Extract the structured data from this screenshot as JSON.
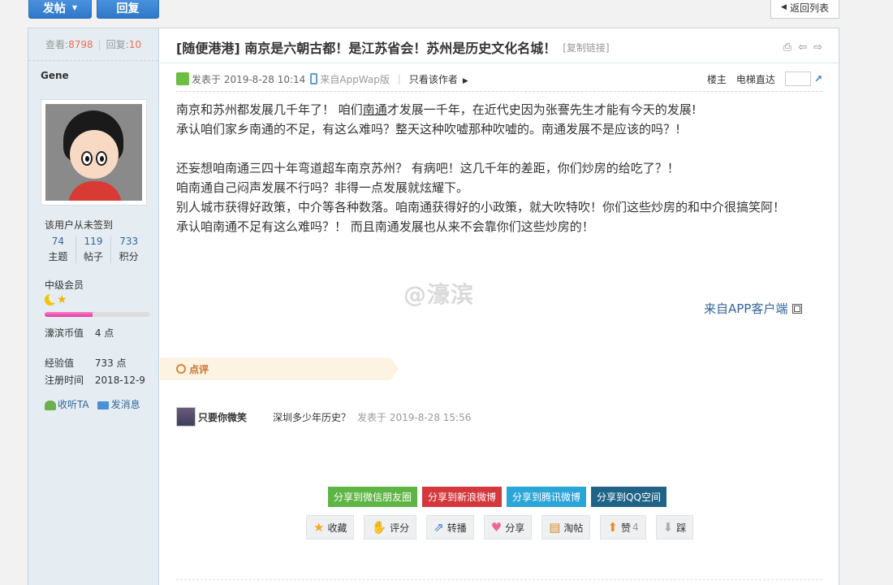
{
  "toolbar": {
    "post_label": "发帖",
    "reply_label": "回复",
    "back_label": "返回列表"
  },
  "sidebar": {
    "views_label": "查看:",
    "views": "8798",
    "replies_label": "回复:",
    "replies": "10",
    "username": "Gene",
    "signin_text": "该用户从未签到",
    "stats": [
      {
        "value": "74",
        "label": "主题"
      },
      {
        "value": "119",
        "label": "帖子"
      },
      {
        "value": "733",
        "label": "积分"
      }
    ],
    "level": "中级会员",
    "level_progress": 0.45,
    "coins_label": "濠滨币值",
    "coins": "4 点",
    "exp_label": "经验值",
    "exp": "733 点",
    "reg_label": "注册时间",
    "reg": "2018-12-9",
    "follow_label": "收听TA",
    "message_label": "发消息"
  },
  "post": {
    "title": "[随便港港] 南京是六朝古都！是江苏省会！苏州是历史文化名城！",
    "copy_link": "[复制链接]",
    "posted_at": "发表于 2019-8-28 10:14",
    "from_app": "来自AppWap版",
    "author_only": "只看该作者",
    "floor_label": "楼主",
    "jump_label": "电梯直达",
    "lines": {
      "l1a": "南京和苏州都发展几千年了！  咱们",
      "l1b": "南通",
      "l1c": "才发展一千年，在近代史因为张謇先生才能有今天的发展!",
      "l2": "承认咱们家乡南通的不足，有这么难吗？整天这种吹嘘那种吹嘘的。南通发展不是应该的吗？!",
      "l3": "还妄想咱南通三四十年弯道超车南京苏州？ 有病吧！这几千年的差距，你们炒房的给吃了？！",
      "l4": "咱南通自己闷声发展不行吗？非得一点发展就炫耀下。",
      "l5": "别人城市获得好政策，中介等各种数落。咱南通获得好的小政策，就大吹特吹！你们这些炒房的和中介很搞笑阿！",
      "l6": "承认咱南通不足有这么难吗？！ 而且南通发展也从来不会靠你们这些炒房的！"
    },
    "watermark": "@濠滨",
    "from_client": "来自APP客户端"
  },
  "review": {
    "tab_label": "点评",
    "comment": {
      "user": "只要你微笑",
      "text": "深圳多少年历史？",
      "time": "发表于 2019-8-28 15:56"
    }
  },
  "share": [
    "分享到微信朋友圈",
    "分享到新浪微博",
    "分享到腾讯微博",
    "分享到QQ空间"
  ],
  "ops": {
    "favorite": "收藏",
    "rate": "评分",
    "repost": "转播",
    "share": "分享",
    "taotie": "淘帖",
    "like": "赞",
    "like_count": "4",
    "dislike": "踩"
  },
  "colors": {
    "accent": "#2f78c9",
    "sidebar_bg": "#e5edf2",
    "link": "#336699",
    "review": "#c8702a"
  }
}
